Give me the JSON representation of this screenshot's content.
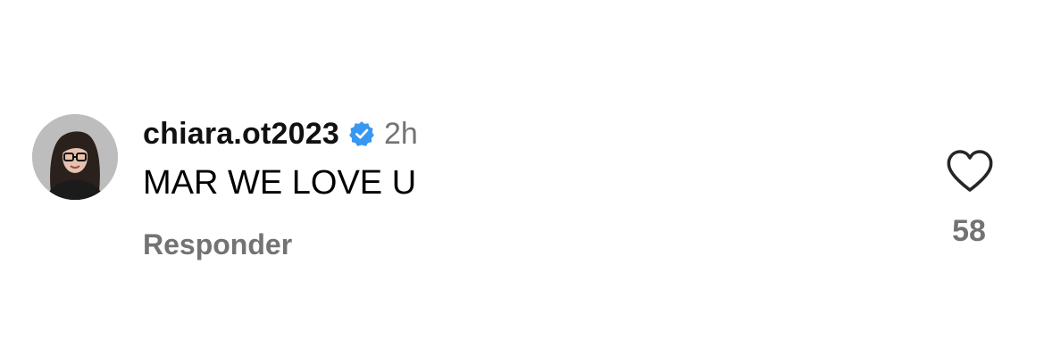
{
  "comment": {
    "username": "chiara.ot2023",
    "verified_icon": "verified-badge-icon",
    "timestamp": "2h",
    "text": "MAR WE LOVE U",
    "reply_label": "Responder",
    "like_icon": "heart-outline-icon",
    "like_count": "58"
  },
  "colors": {
    "verified_blue": "#3897f0",
    "secondary_text": "#737373",
    "primary_text": "#000000"
  }
}
